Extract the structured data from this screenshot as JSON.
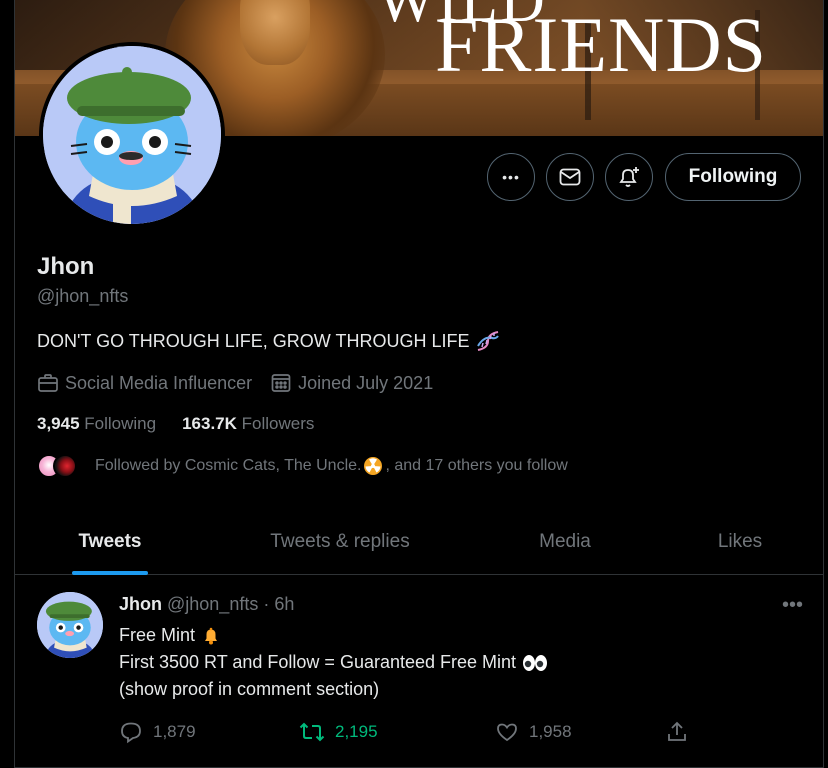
{
  "banner": {
    "title_line1": "WILD",
    "title_line2": "FRIENDS"
  },
  "actions": {
    "more_label": "•••",
    "follow_label": "Following"
  },
  "profile": {
    "name": "Jhon",
    "handle": "@jhon_nfts",
    "bio": "DON'T GO THROUGH LIFE, GROW THROUGH LIFE",
    "category": "Social Media Influencer",
    "joined": "Joined July 2021",
    "following_count": "3,945",
    "following_label": "Following",
    "followers_count": "163.7K",
    "followers_label": "Followers",
    "followed_by_prefix": "Followed by Cosmic Cats, The Uncle.",
    "followed_by_suffix": ", and 17 others you follow"
  },
  "tabs": [
    {
      "label": "Tweets",
      "active": true
    },
    {
      "label": "Tweets & replies",
      "active": false
    },
    {
      "label": "Media",
      "active": false
    },
    {
      "label": "Likes",
      "active": false
    }
  ],
  "tweet": {
    "name": "Jhon",
    "handle": "@jhon_nfts",
    "time": "· 6h",
    "line1": "Free Mint",
    "line2": "First 3500 RT and Follow  = Guaranteed Free Mint",
    "line3": "(show proof in comment section)",
    "more": "•••",
    "replies": "1,879",
    "retweets": "2,195",
    "likes": "1,958"
  },
  "colors": {
    "accent": "#1d9bf0",
    "retweet": "#00ba7c",
    "muted": "#71767b",
    "border": "#2f3336"
  }
}
